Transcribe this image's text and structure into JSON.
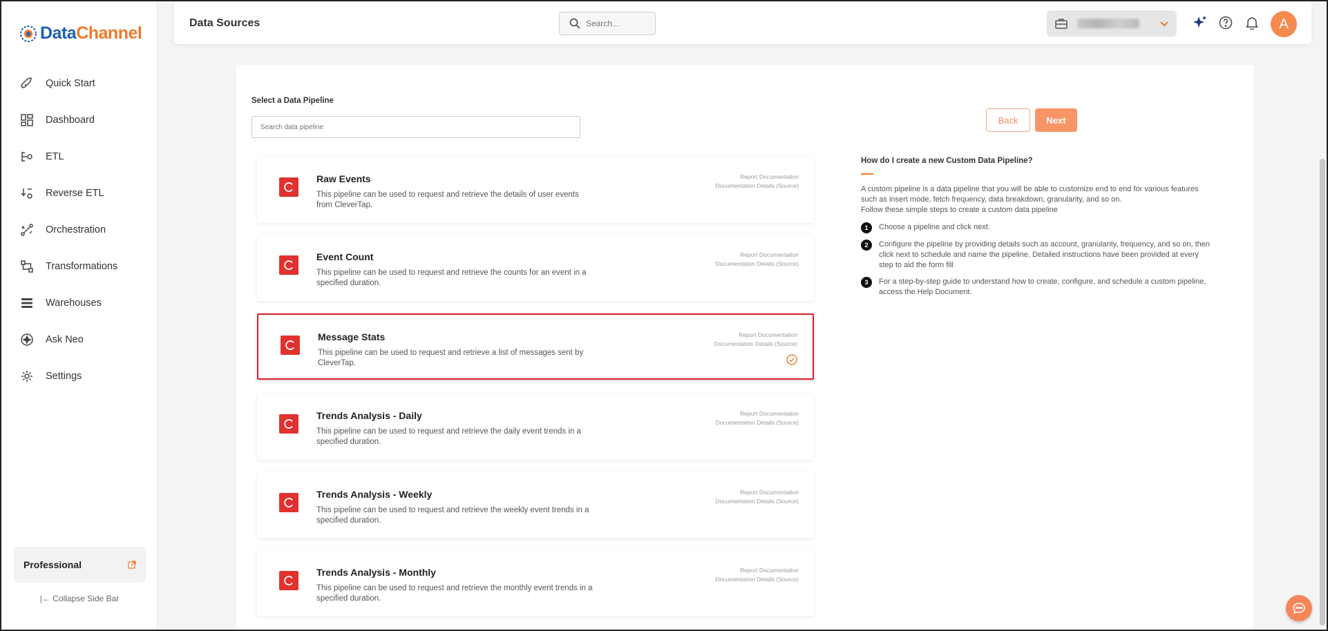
{
  "brand": {
    "part1": "Data",
    "part2": "Channel"
  },
  "sidebar": {
    "items": [
      {
        "label": "Quick Start",
        "icon": "rocket-icon"
      },
      {
        "label": "Dashboard",
        "icon": "dashboard-icon"
      },
      {
        "label": "ETL",
        "icon": "etl-icon"
      },
      {
        "label": "Reverse ETL",
        "icon": "reverse-etl-icon"
      },
      {
        "label": "Orchestration",
        "icon": "orchestration-icon"
      },
      {
        "label": "Transformations",
        "icon": "transformations-icon"
      },
      {
        "label": "Warehouses",
        "icon": "warehouses-icon"
      },
      {
        "label": "Ask Neo",
        "icon": "ask-neo-icon"
      },
      {
        "label": "Settings",
        "icon": "settings-icon"
      }
    ],
    "plan": "Professional",
    "collapse_label": "Collapse Side Bar"
  },
  "header": {
    "title": "Data Sources",
    "search_placeholder": "Search...",
    "avatar_initial": "A"
  },
  "main": {
    "section_label": "Select a Data Pipeline",
    "pipeline_search_placeholder": "Search data pipeline",
    "back_label": "Back",
    "next_label": "Next",
    "pipelines": [
      {
        "title": "Raw Events",
        "desc": "This pipeline can be used to request and retrieve the details of user events from CleverTap.",
        "link1": "Report Documentation",
        "link2": "Documentation Details (Source)",
        "selected": false
      },
      {
        "title": "Event Count",
        "desc": "This pipeline can be used to request and retrieve the counts for an event in a specified duration.",
        "link1": "Report Documentation",
        "link2": "Documentation Details (Source)",
        "selected": false
      },
      {
        "title": "Message Stats",
        "desc": "This pipeline can be used to request and retrieve a list of messages sent by CleverTap.",
        "link1": "Report Documentation",
        "link2": "Documentation Details (Source)",
        "selected": true
      },
      {
        "title": "Trends Analysis - Daily",
        "desc": "This pipeline can be used to request and retrieve the daily event trends in a specified duration.",
        "link1": "Report Documentation",
        "link2": "Documentation Details (Source)",
        "selected": false
      },
      {
        "title": "Trends Analysis - Weekly",
        "desc": "This pipeline can be used to request and retrieve the weekly event trends in a specified duration.",
        "link1": "Report Documentation",
        "link2": "Documentation Details (Source)",
        "selected": false
      },
      {
        "title": "Trends Analysis - Monthly",
        "desc": "This pipeline can be used to request and retrieve the monthly event trends in a specified duration.",
        "link1": "Report Documentation",
        "link2": "Documentation Details (Source)",
        "selected": false
      }
    ]
  },
  "help": {
    "title": "How do I create a new Custom Data Pipeline?",
    "para1": "A custom pipeline is a data pipeline that you will be able to customize end to end for various features such as insert mode, fetch frequency, data breakdown, granularity, and so on.",
    "para2": "Follow these simple steps to create a custom data pipeline",
    "steps": [
      {
        "num": "1",
        "text": "Choose a pipeline and click next."
      },
      {
        "num": "2",
        "text": "Configure the pipeline by providing details such as account, granularity, frequency, and so on, then click next to schedule and name the pipeline. Detailed instructions have been provided at every step to aid the form fill"
      },
      {
        "num": "3",
        "text": "For a step-by-step guide to understand how to create, configure, and schedule a custom pipeline, access the Help Document."
      }
    ]
  },
  "colors": {
    "accent": "#f79566",
    "brand_blue": "#1f5fb4",
    "brand_orange": "#f07a2a",
    "selected_border": "#d91e25",
    "clevertap_red": "#e0322f"
  }
}
